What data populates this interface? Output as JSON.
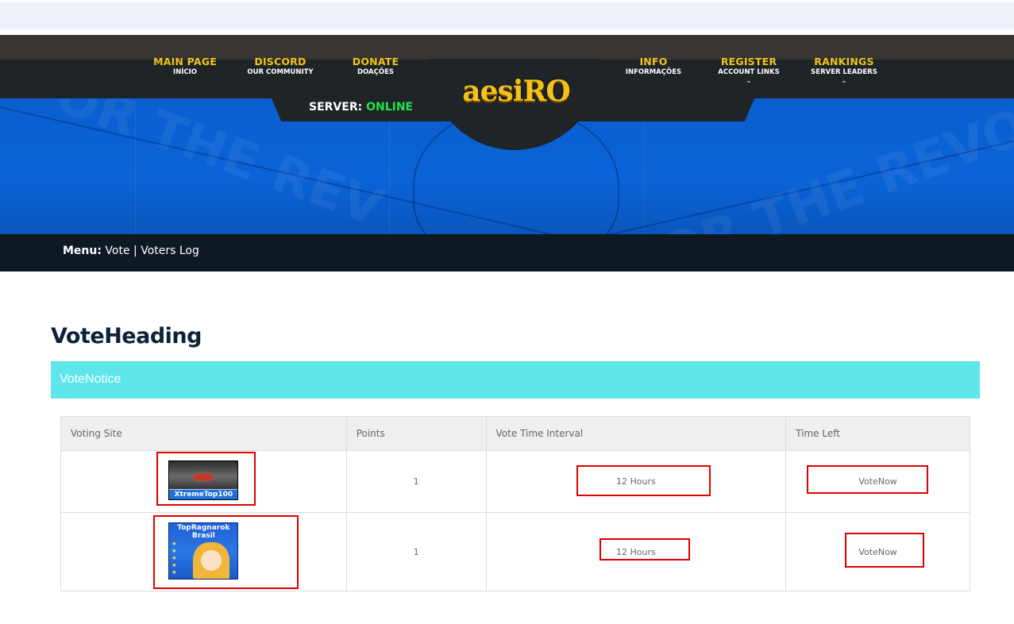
{
  "nav": {
    "left": [
      {
        "title": "MAIN PAGE",
        "sub": "INÍCIO"
      },
      {
        "title": "DISCORD",
        "sub": "OUR COMMUNITY"
      },
      {
        "title": "DONATE",
        "sub": "DOAÇÕES"
      }
    ],
    "right": [
      {
        "title": "INFO",
        "sub": "INFORMAÇÕES"
      },
      {
        "title": "REGISTER",
        "sub": "ACCOUNT LINKS",
        "chevron": "chevron-down-icon"
      },
      {
        "title": "RANKINGS",
        "sub": "SERVER LEADERS",
        "chevron": "chevron-down-icon"
      }
    ]
  },
  "logo": "aesiRO",
  "server": {
    "label": "SERVER:",
    "status": "ONLINE",
    "status_color": "#23e24a"
  },
  "menu": {
    "label": "Menu:",
    "vote": "Vote",
    "separator": "|",
    "voters_log": "Voters Log"
  },
  "page": {
    "heading": "VoteHeading",
    "notice": "VoteNotice"
  },
  "colors": {
    "accent": "#f0c419",
    "notice_bg": "#5ee6ea",
    "highlight": "#e00000"
  },
  "table": {
    "headers": [
      "Voting Site",
      "Points",
      "Vote Time Interval",
      "Time Left"
    ],
    "rows": [
      {
        "site_banner": "XtremeTop100",
        "points": "1",
        "interval": "12 Hours",
        "time_left": "VoteNow"
      },
      {
        "site_banner_line1": "TopRagnarok",
        "site_banner_line2": "Brasil",
        "points": "1",
        "interval": "12 Hours",
        "time_left": "VoteNow"
      }
    ]
  }
}
